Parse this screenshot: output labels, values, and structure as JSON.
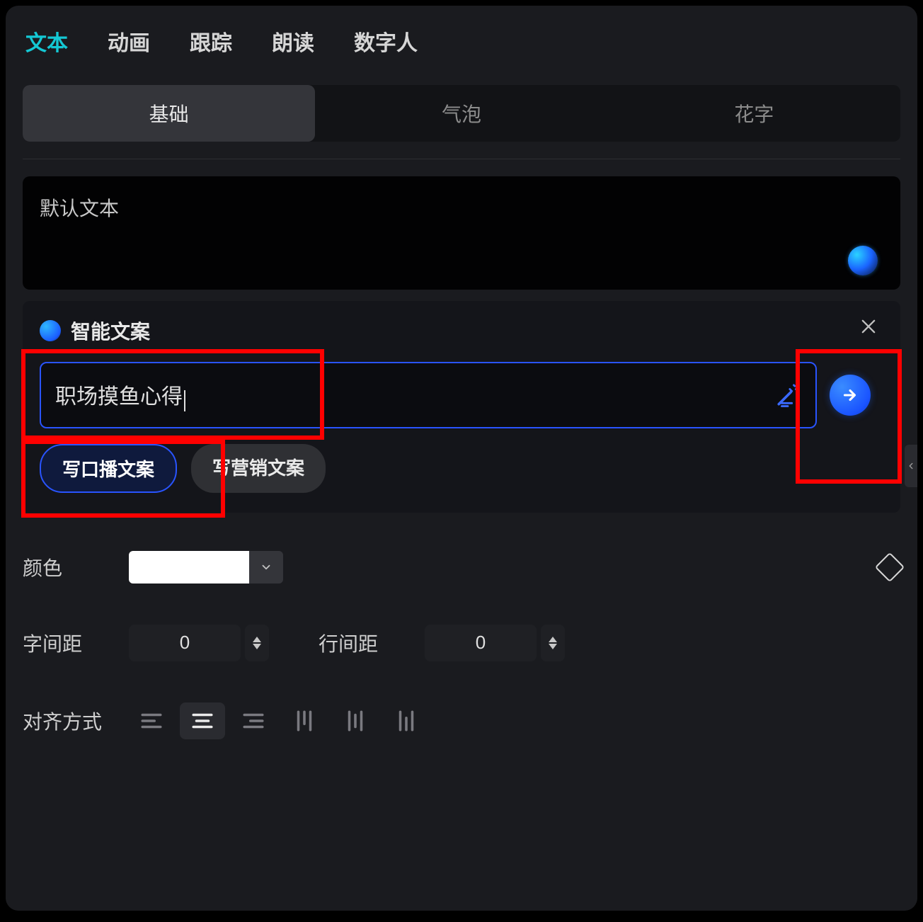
{
  "topTabs": {
    "items": [
      "文本",
      "动画",
      "跟踪",
      "朗读",
      "数字人"
    ],
    "active": 0
  },
  "subTabs": {
    "items": [
      "基础",
      "气泡",
      "花字"
    ],
    "active": 0
  },
  "textBox": {
    "content": "默认文本"
  },
  "smartPanel": {
    "title": "智能文案",
    "inputValue": "职场摸鱼心得",
    "chips": [
      "写口播文案",
      "写营销文案"
    ],
    "activeChip": 0
  },
  "controls": {
    "colorLabel": "颜色",
    "colorValue": "#FFFFFF",
    "letterSpacingLabel": "字间距",
    "letterSpacingValue": "0",
    "lineSpacingLabel": "行间距",
    "lineSpacingValue": "0",
    "alignLabel": "对齐方式",
    "alignActive": 1
  },
  "colors": {
    "accent": "#14c8d4",
    "primary": "#2954ff",
    "highlight": "#ff0000"
  }
}
